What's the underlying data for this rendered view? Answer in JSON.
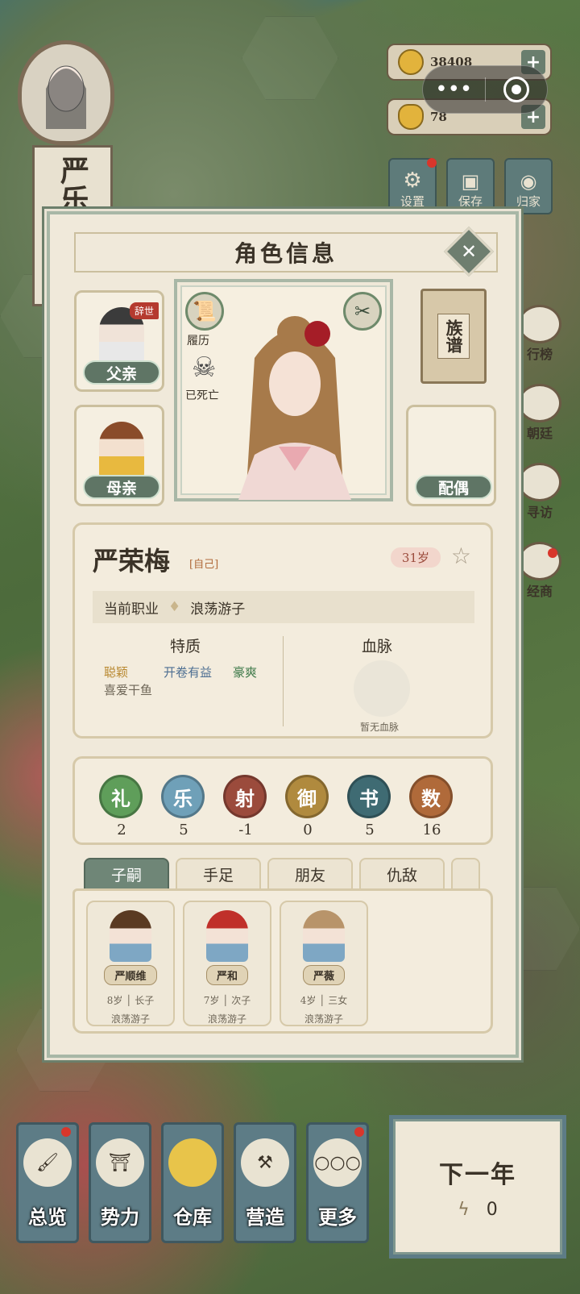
{
  "hud": {
    "player_name": "严乐",
    "copper_coins": "38408",
    "gold_ingots": "78",
    "top_buttons": [
      "设置",
      "保存",
      "归家"
    ],
    "side_buttons": [
      "行榜",
      "朝廷",
      "寻访",
      "经商"
    ]
  },
  "panel": {
    "title": "角色信息",
    "father_label": "父亲",
    "father_status": "辞世",
    "mother_label": "母亲",
    "spouse_label": "配偶",
    "resume_label": "履历",
    "deceased_label": "已死亡",
    "genealogy_label": "族谱",
    "character": {
      "name": "严荣梅",
      "self_tag": "[自己]",
      "age": "31岁",
      "job_label": "当前职业",
      "job": "浪荡游子"
    },
    "traits_label": "特质",
    "traits": [
      "聪颖",
      "开卷有益",
      "豪爽",
      "喜爱干鱼"
    ],
    "bloodline_label": "血脉",
    "bloodline_none": "暂无血脉",
    "stats": [
      {
        "name": "礼",
        "value": "2",
        "color": "#5f9e5a"
      },
      {
        "name": "乐",
        "value": "5",
        "color": "#6fa0b8"
      },
      {
        "name": "射",
        "value": "-1",
        "color": "#9b4b3c"
      },
      {
        "name": "御",
        "value": "0",
        "color": "#b08a3e"
      },
      {
        "name": "书",
        "value": "5",
        "color": "#3f6b73"
      },
      {
        "name": "数",
        "value": "16",
        "color": "#b06a3a"
      }
    ],
    "tabs": [
      "子嗣",
      "手足",
      "朋友",
      "仇敌"
    ],
    "children": [
      {
        "name": "严顺维",
        "age": "8岁",
        "rank": "长子",
        "job": "浪荡游子"
      },
      {
        "name": "严和",
        "age": "7岁",
        "rank": "次子",
        "job": "浪荡游子"
      },
      {
        "name": "严薇",
        "age": "4岁",
        "rank": "三女",
        "job": "浪荡游子"
      }
    ]
  },
  "bottom_nav": [
    "总览",
    "势力",
    "仓库",
    "营造",
    "更多"
  ],
  "next_year": {
    "label": "下一年",
    "energy": "0"
  }
}
